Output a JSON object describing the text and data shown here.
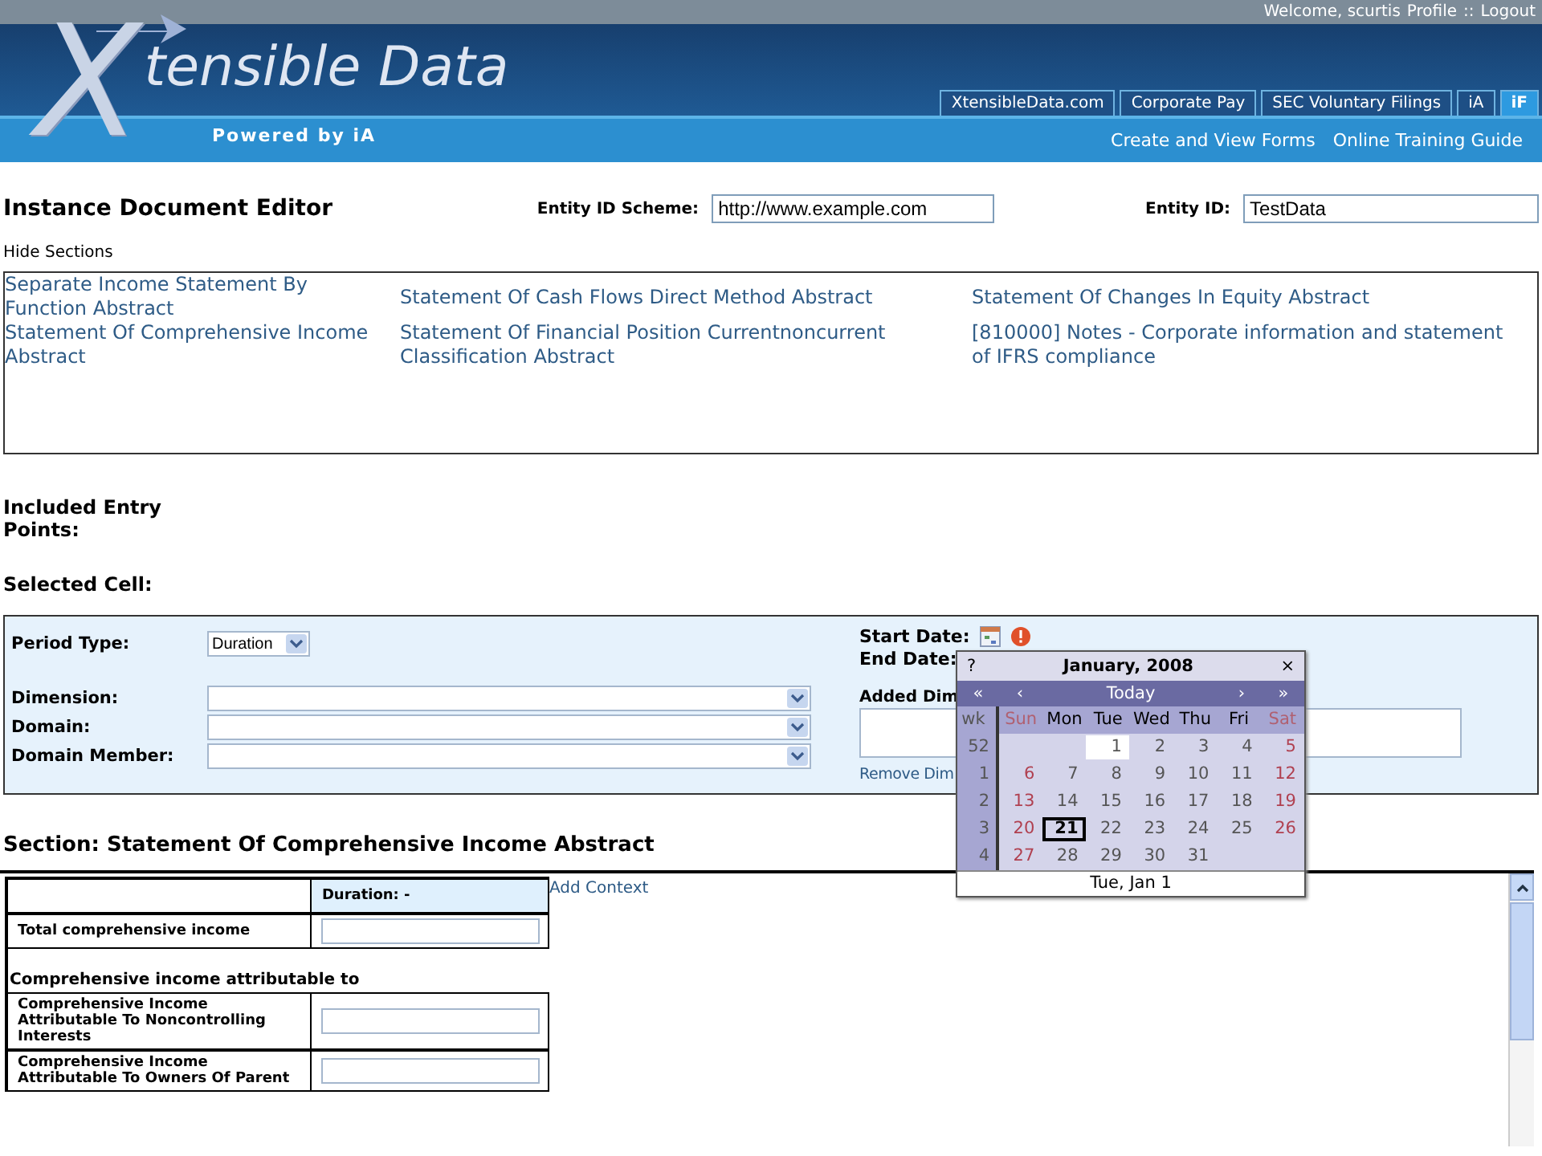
{
  "header": {
    "welcome": "Welcome, scurtis",
    "profile_link": "Profile",
    "separator": "::",
    "logout_link": "Logout",
    "logo_letter": "X",
    "logo_text": "tensible Data",
    "tagline": "Powered by iA",
    "tabs": [
      {
        "label": "XtensibleData.com",
        "selected": false
      },
      {
        "label": "Corporate Pay",
        "selected": false
      },
      {
        "label": "SEC Voluntary Filings",
        "selected": false
      },
      {
        "label": "iA",
        "selected": false
      },
      {
        "label": "iF",
        "selected": true
      }
    ],
    "links": [
      "Create and View Forms",
      "Online Training Guide"
    ]
  },
  "editor": {
    "title": "Instance Document Editor",
    "scheme_label": "Entity ID Scheme:",
    "scheme_value": "http://www.example.com",
    "id_label": "Entity ID:",
    "id_value": "TestData"
  },
  "hide_sections": "Hide Sections",
  "sections": [
    "Separate Income Statement By Function Abstract",
    "Statement Of Cash Flows Direct Method Abstract",
    "Statement Of Changes In Equity Abstract",
    "Statement Of Comprehensive Income Abstract",
    "Statement Of Financial Position Currentnoncurrent Classification Abstract",
    "[810000] Notes - Corporate information and statement of IFRS compliance"
  ],
  "included_entry_points": "Included Entry Points:",
  "selected_cell": "Selected Cell:",
  "cell_panel": {
    "period_label": "Period Type:",
    "period_value": "Duration",
    "selects": [
      "Dimension:",
      "Domain:",
      "Domain Member:"
    ],
    "start_date": "Start Date:",
    "end_date": "End Date:",
    "added_dim": "Added Dim",
    "remove_dim": "Remove Dim"
  },
  "calendar": {
    "help": "?",
    "title": "January, 2008",
    "close": "×",
    "nav": [
      "«",
      "‹",
      "Today",
      "›",
      "»"
    ],
    "wk": "wk",
    "weekdays": [
      "Sun",
      "Mon",
      "Tue",
      "Wed",
      "Thu",
      "Fri",
      "Sat"
    ],
    "weeks": [
      {
        "wk": "52",
        "kind": "first",
        "days": [
          {
            "d": "1",
            "selected": true,
            "today": false
          },
          {
            "d": "2",
            "selected": false,
            "today": false
          },
          {
            "d": "3",
            "selected": false,
            "today": false
          },
          {
            "d": "4",
            "selected": false,
            "today": false
          },
          {
            "d": "5",
            "selected": false,
            "today": false
          }
        ]
      },
      {
        "wk": "1",
        "kind": "full",
        "days": [
          {
            "d": "6",
            "selected": false,
            "today": false
          },
          {
            "d": "7",
            "selected": false,
            "today": false
          },
          {
            "d": "8",
            "selected": false,
            "today": false
          },
          {
            "d": "9",
            "selected": false,
            "today": false
          },
          {
            "d": "10",
            "selected": false,
            "today": false
          },
          {
            "d": "11",
            "selected": false,
            "today": false
          },
          {
            "d": "12",
            "selected": false,
            "today": false
          }
        ]
      },
      {
        "wk": "2",
        "kind": "full",
        "days": [
          {
            "d": "13",
            "selected": false,
            "today": false
          },
          {
            "d": "14",
            "selected": false,
            "today": false
          },
          {
            "d": "15",
            "selected": false,
            "today": false
          },
          {
            "d": "16",
            "selected": false,
            "today": false
          },
          {
            "d": "17",
            "selected": false,
            "today": false
          },
          {
            "d": "18",
            "selected": false,
            "today": false
          },
          {
            "d": "19",
            "selected": false,
            "today": false
          }
        ]
      },
      {
        "wk": "3",
        "kind": "full",
        "days": [
          {
            "d": "20",
            "selected": false,
            "today": false
          },
          {
            "d": "21",
            "selected": false,
            "today": true
          },
          {
            "d": "22",
            "selected": false,
            "today": false
          },
          {
            "d": "23",
            "selected": false,
            "today": false
          },
          {
            "d": "24",
            "selected": false,
            "today": false
          },
          {
            "d": "25",
            "selected": false,
            "today": false
          },
          {
            "d": "26",
            "selected": false,
            "today": false
          }
        ]
      },
      {
        "wk": "4",
        "kind": "last",
        "days": [
          {
            "d": "27",
            "selected": false,
            "today": false
          },
          {
            "d": "28",
            "selected": false,
            "today": false
          },
          {
            "d": "29",
            "selected": false,
            "today": false
          },
          {
            "d": "30",
            "selected": false,
            "today": false
          },
          {
            "d": "31",
            "selected": false,
            "today": false
          }
        ]
      }
    ],
    "footer": "Tue, Jan 1"
  },
  "section": {
    "title": "Section: Statement Of Comprehensive Income Abstract",
    "column": "Duration: -",
    "add_context": "Add Context",
    "rows": [
      {
        "kind": "item",
        "label": "Total comprehensive income"
      },
      {
        "kind": "group",
        "label": "Comprehensive income attributable to"
      },
      {
        "kind": "item",
        "label": "Comprehensive Income Attributable To Noncontrolling Interests"
      },
      {
        "kind": "item",
        "label": "Comprehensive Income Attributable To Owners Of Parent"
      }
    ]
  }
}
